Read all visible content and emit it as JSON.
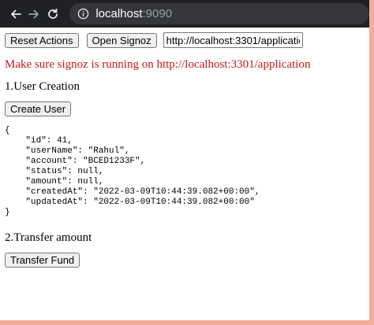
{
  "browser": {
    "url_host": "localhost",
    "url_port": ":9090"
  },
  "toolbar": {
    "reset_label": "Reset Actions",
    "signoz_label": "Open Signoz",
    "url_input_value": "http://localhost:3301/application"
  },
  "warning": "Make sure signoz is running on http://localhost:3301/application",
  "section1": {
    "title": "1.User Creation",
    "button_label": "Create User",
    "response_json": "{\n    \"id\": 41,\n    \"userName\": \"Rahul\",\n    \"account\": \"BCED1233F\",\n    \"status\": null,\n    \"amount\": null,\n    \"createdAt\": \"2022-03-09T10:44:39.082+00:00\",\n    \"updatedAt\": \"2022-03-09T10:44:39.082+00:00\"\n}"
  },
  "section2": {
    "title": "2.Transfer amount",
    "button_label": "Transfer Fund"
  },
  "colors": {
    "frame_border": "#f2ad98",
    "warning": "#c41a1a",
    "browser_toolbar": "#202124"
  },
  "icons": [
    "back-arrow-icon",
    "forward-arrow-icon",
    "reload-icon",
    "info-icon"
  ]
}
